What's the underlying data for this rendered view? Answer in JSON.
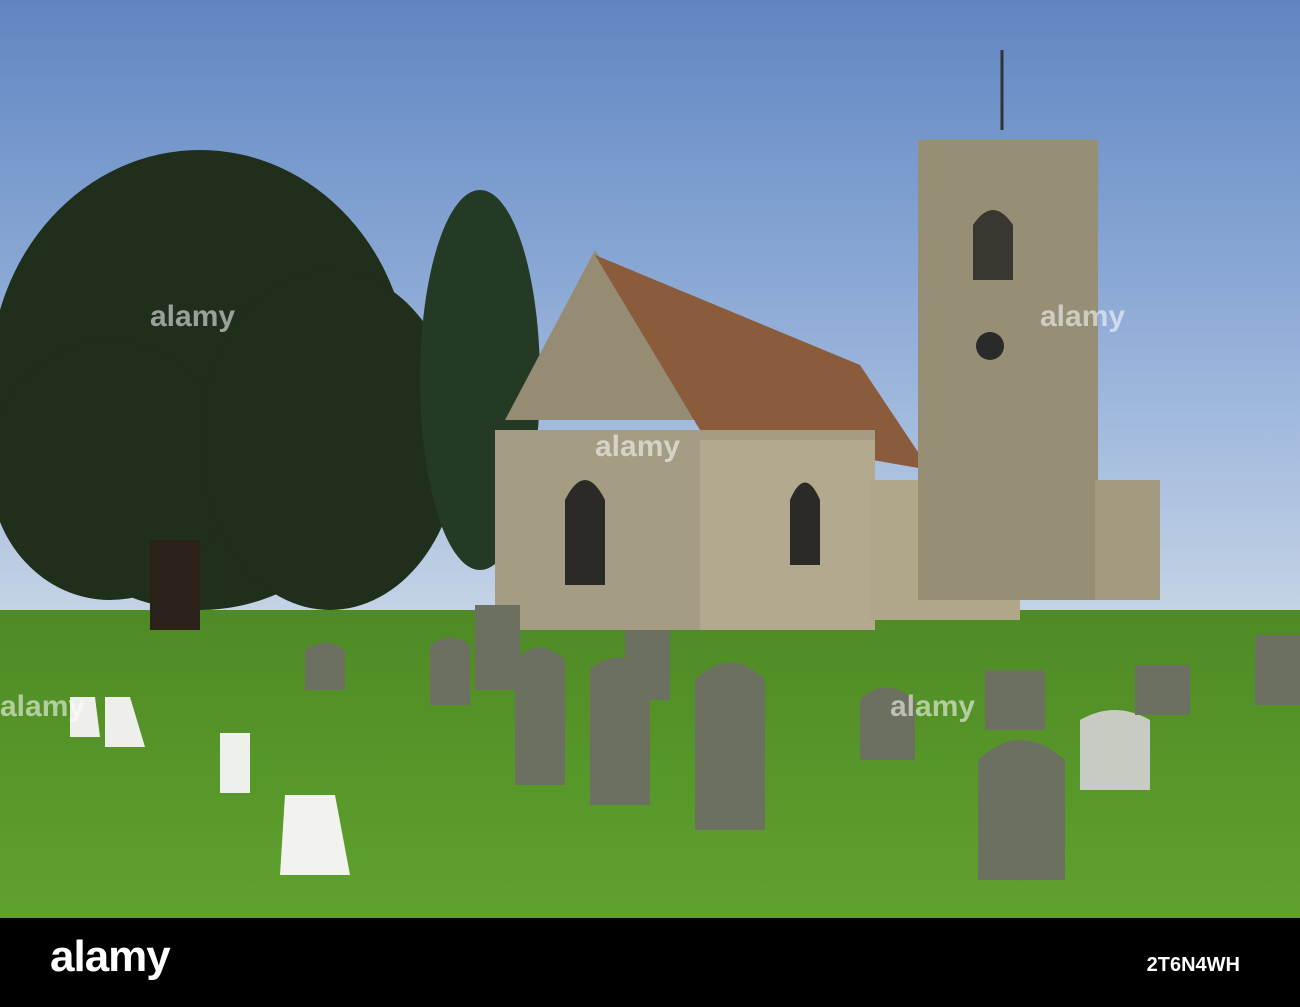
{
  "watermark": {
    "brand": "alamy",
    "image_id": "2T6N4WH"
  },
  "colors": {
    "sky": "#6f93c9",
    "grass": "#5a9a2a",
    "stone": "#a39a82",
    "yew": "#1f2f1c",
    "bar": "#000000"
  }
}
